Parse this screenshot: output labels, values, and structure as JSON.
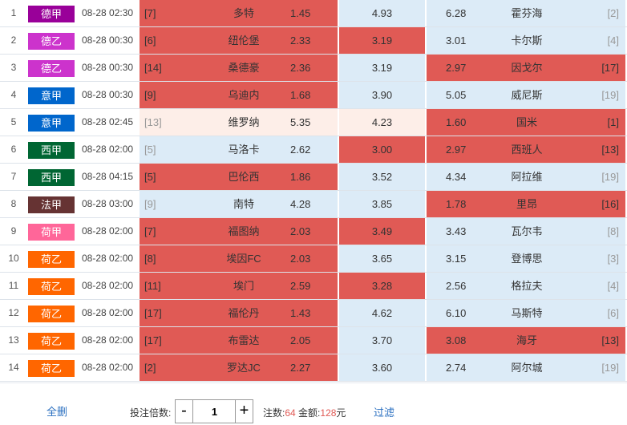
{
  "matches": [
    {
      "index": "1",
      "league": "德甲",
      "league_color": "#990099",
      "time": "08-28 02:30",
      "home_rank": "[7]",
      "home_team": "多特",
      "home_odd": "1.45",
      "draw_odd": "4.93",
      "away_odd": "6.28",
      "away_team": "霍芬海",
      "away_rank": "[2]",
      "home_state": "sel",
      "draw_state": "uns",
      "away_state": "uns"
    },
    {
      "index": "2",
      "league": "德乙",
      "league_color": "#cc33cc",
      "time": "08-28 00:30",
      "home_rank": "[6]",
      "home_team": "纽伦堡",
      "home_odd": "2.33",
      "draw_odd": "3.19",
      "away_odd": "3.01",
      "away_team": "卡尔斯",
      "away_rank": "[4]",
      "home_state": "sel",
      "draw_state": "sel",
      "away_state": "uns"
    },
    {
      "index": "3",
      "league": "德乙",
      "league_color": "#cc33cc",
      "time": "08-28 00:30",
      "home_rank": "[14]",
      "home_team": "桑德豪",
      "home_odd": "2.36",
      "draw_odd": "3.19",
      "away_odd": "2.97",
      "away_team": "因戈尔",
      "away_rank": "[17]",
      "home_state": "sel",
      "draw_state": "uns",
      "away_state": "sel"
    },
    {
      "index": "4",
      "league": "意甲",
      "league_color": "#0066cc",
      "time": "08-28 00:30",
      "home_rank": "[9]",
      "home_team": "乌迪内",
      "home_odd": "1.68",
      "draw_odd": "3.90",
      "away_odd": "5.05",
      "away_team": "威尼斯",
      "away_rank": "[19]",
      "home_state": "sel",
      "draw_state": "uns",
      "away_state": "uns"
    },
    {
      "index": "5",
      "league": "意甲",
      "league_color": "#0066cc",
      "time": "08-28 02:45",
      "home_rank": "[13]",
      "home_team": "维罗纳",
      "home_odd": "5.35",
      "draw_odd": "4.23",
      "away_odd": "1.60",
      "away_team": "国米",
      "away_rank": "[1]",
      "home_state": "pale",
      "draw_state": "pale",
      "away_state": "sel"
    },
    {
      "index": "6",
      "league": "西甲",
      "league_color": "#006633",
      "time": "08-28 02:00",
      "home_rank": "[5]",
      "home_team": "马洛卡",
      "home_odd": "2.62",
      "draw_odd": "3.00",
      "away_odd": "2.97",
      "away_team": "西班人",
      "away_rank": "[13]",
      "home_state": "uns",
      "draw_state": "sel",
      "away_state": "sel"
    },
    {
      "index": "7",
      "league": "西甲",
      "league_color": "#006633",
      "time": "08-28 04:15",
      "home_rank": "[5]",
      "home_team": "巴伦西",
      "home_odd": "1.86",
      "draw_odd": "3.52",
      "away_odd": "4.34",
      "away_team": "阿拉维",
      "away_rank": "[19]",
      "home_state": "sel",
      "draw_state": "uns",
      "away_state": "uns"
    },
    {
      "index": "8",
      "league": "法甲",
      "league_color": "#663333",
      "time": "08-28 03:00",
      "home_rank": "[9]",
      "home_team": "南特",
      "home_odd": "4.28",
      "draw_odd": "3.85",
      "away_odd": "1.78",
      "away_team": "里昂",
      "away_rank": "[16]",
      "home_state": "uns",
      "draw_state": "uns",
      "away_state": "sel"
    },
    {
      "index": "9",
      "league": "荷甲",
      "league_color": "#ff6699",
      "time": "08-28 02:00",
      "home_rank": "[7]",
      "home_team": "福图纳",
      "home_odd": "2.03",
      "draw_odd": "3.49",
      "away_odd": "3.43",
      "away_team": "瓦尔韦",
      "away_rank": "[8]",
      "home_state": "sel",
      "draw_state": "sel",
      "away_state": "uns"
    },
    {
      "index": "10",
      "league": "荷乙",
      "league_color": "#ff6600",
      "time": "08-28 02:00",
      "home_rank": "[8]",
      "home_team": "埃因FC",
      "home_odd": "2.03",
      "draw_odd": "3.65",
      "away_odd": "3.15",
      "away_team": "登博思",
      "away_rank": "[3]",
      "home_state": "sel",
      "draw_state": "uns",
      "away_state": "uns"
    },
    {
      "index": "11",
      "league": "荷乙",
      "league_color": "#ff6600",
      "time": "08-28 02:00",
      "home_rank": "[11]",
      "home_team": "埃门",
      "home_odd": "2.59",
      "draw_odd": "3.28",
      "away_odd": "2.56",
      "away_team": "格拉夫",
      "away_rank": "[4]",
      "home_state": "sel",
      "draw_state": "sel",
      "away_state": "uns"
    },
    {
      "index": "12",
      "league": "荷乙",
      "league_color": "#ff6600",
      "time": "08-28 02:00",
      "home_rank": "[17]",
      "home_team": "福伦丹",
      "home_odd": "1.43",
      "draw_odd": "4.62",
      "away_odd": "6.10",
      "away_team": "马斯特",
      "away_rank": "[6]",
      "home_state": "sel",
      "draw_state": "uns",
      "away_state": "uns"
    },
    {
      "index": "13",
      "league": "荷乙",
      "league_color": "#ff6600",
      "time": "08-28 02:00",
      "home_rank": "[17]",
      "home_team": "布雷达",
      "home_odd": "2.05",
      "draw_odd": "3.70",
      "away_odd": "3.08",
      "away_team": "海牙",
      "away_rank": "[13]",
      "home_state": "sel",
      "draw_state": "uns",
      "away_state": "sel"
    },
    {
      "index": "14",
      "league": "荷乙",
      "league_color": "#ff6600",
      "time": "08-28 02:00",
      "home_rank": "[2]",
      "home_team": "罗达JC",
      "home_odd": "2.27",
      "draw_odd": "3.60",
      "away_odd": "2.74",
      "away_team": "阿尔城",
      "away_rank": "[19]",
      "home_state": "sel",
      "draw_state": "uns",
      "away_state": "uns"
    }
  ],
  "footer": {
    "clear_label": "全删",
    "multiplier_label": "投注倍数:",
    "minus_label": "-",
    "plus_label": "+",
    "multiplier_value": "1",
    "notes_label": "注数:",
    "notes_value": "64",
    "amount_label": "金额:",
    "amount_value": "128",
    "amount_unit": "元",
    "filter_label": "过滤"
  },
  "colors": {
    "selected": "#e05a55",
    "unselected": "#dcebf7",
    "link": "#2a6fc0"
  }
}
